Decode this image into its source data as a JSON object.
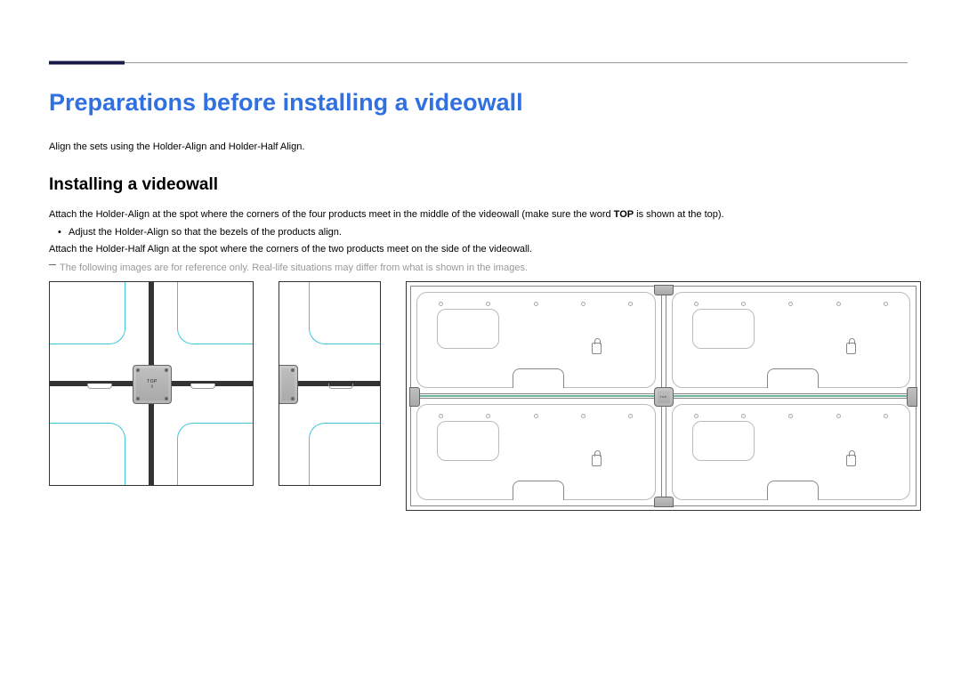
{
  "page": {
    "title": "Preparations before installing a videowall",
    "intro": "Align the sets using the Holder-Align and Holder-Half Align.",
    "subtitle": "Installing a videowall",
    "para1_prefix": "Attach the Holder-Align at the spot where the corners of the four products meet in the middle of the videowall (make sure the word ",
    "para1_bold": "TOP",
    "para1_suffix": " is shown at the top).",
    "bullet1": "Adjust the Holder-Align so that the bezels of the products align.",
    "para2": "Attach the Holder-Half Align at the spot where the corners of the two products meet on the side of the videowall.",
    "note": "The following images are for reference only. Real-life situations may differ from what is shown in the images."
  },
  "holder": {
    "label_top": "TOP",
    "arrow": "⇧"
  }
}
